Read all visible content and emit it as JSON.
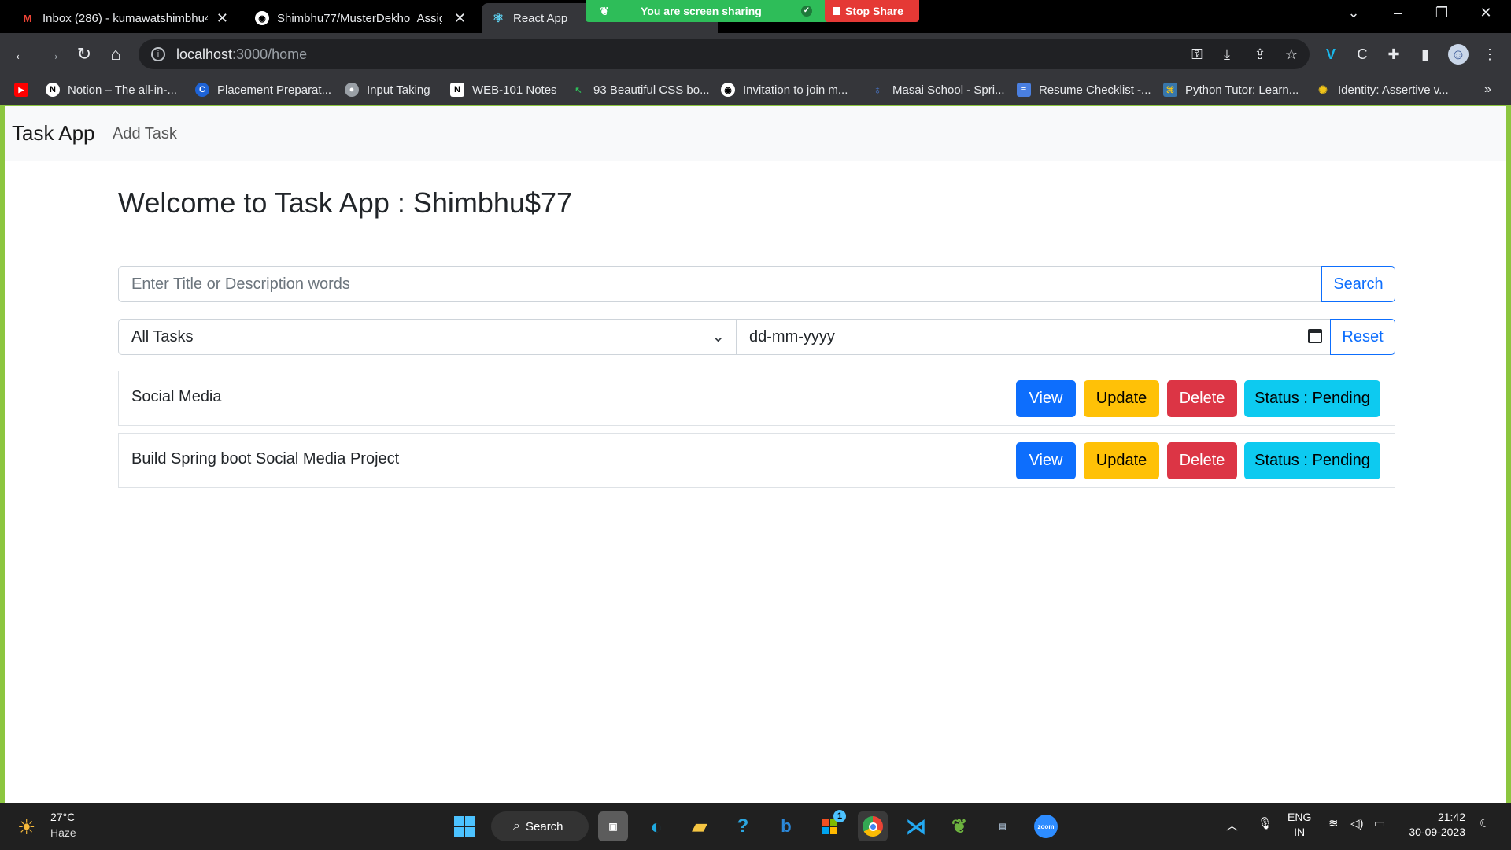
{
  "browser": {
    "tabs": [
      {
        "title": "Inbox (286) - kumawatshimbhu4",
        "icon": "gmail-icon"
      },
      {
        "title": "Shimbhu77/MusterDekho_Assig",
        "icon": "github-icon"
      },
      {
        "title": "React App",
        "icon": "react-icon"
      }
    ],
    "share_bar": {
      "message": "You are screen sharing",
      "stop_label": "Stop Share"
    },
    "url_host": "localhost",
    "url_path": ":3000/home",
    "bookmarks": [
      {
        "label": "Notion – The all-in-...",
        "color": "#ffffff"
      },
      {
        "label": "Placement Preparat...",
        "color": "#1e63d6"
      },
      {
        "label": "Input Taking",
        "color": "#9aa0a6"
      },
      {
        "label": "WEB-101 Notes",
        "color": "#ffffff"
      },
      {
        "label": "93 Beautiful CSS bo...",
        "color": "#2ebd59"
      },
      {
        "label": "Invitation to join m...",
        "color": "#ffffff"
      },
      {
        "label": "Masai School - Spri...",
        "color": "#4a7fe0"
      },
      {
        "label": "Resume Checklist -...",
        "color": "#4a7fe0"
      },
      {
        "label": "Python Tutor: Learn...",
        "color": "#f0c419"
      },
      {
        "label": "Identity: Assertive v...",
        "color": "#f0c419"
      }
    ]
  },
  "app": {
    "brand": "Task App",
    "nav_add": "Add Task",
    "welcome": "Welcome to Task App : Shimbhu$77",
    "search": {
      "placeholder": "Enter Title or Description words",
      "button": "Search"
    },
    "filter": {
      "selected": "All Tasks",
      "date_placeholder": "dd-mm-yyyy",
      "reset": "Reset"
    },
    "tasks": [
      {
        "title": "Social Media",
        "view": "View",
        "update": "Update",
        "delete": "Delete",
        "status": "Status : Pending"
      },
      {
        "title": "Build Spring boot Social Media Project",
        "view": "View",
        "update": "Update",
        "delete": "Delete",
        "status": "Status : Pending"
      }
    ]
  },
  "taskbar": {
    "weather_temp": "27°C",
    "weather_desc": "Haze",
    "search_label": "Search",
    "store_badge": "1",
    "lang_top": "ENG",
    "lang_bottom": "IN",
    "time": "21:42",
    "date": "30-09-2023"
  },
  "colors": {
    "primary": "#0d6efd",
    "warning": "#ffc107",
    "danger": "#dc3545",
    "info": "#0dcaf0",
    "share_green": "#2ebd59",
    "frame_green": "#8cc63f"
  }
}
